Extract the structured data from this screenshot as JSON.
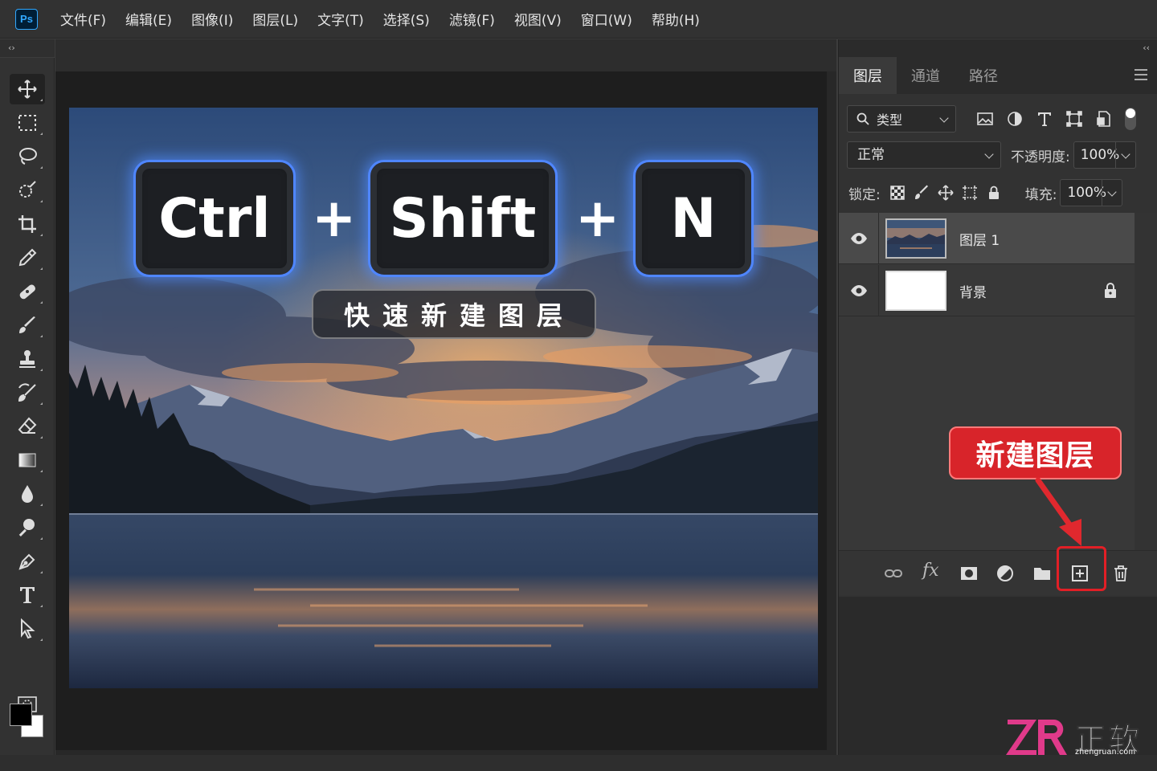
{
  "app": {
    "logo": "Ps"
  },
  "menubar": {
    "items": [
      "文件(F)",
      "编辑(E)",
      "图像(I)",
      "图层(L)",
      "文字(T)",
      "选择(S)",
      "滤镜(F)",
      "视图(V)",
      "窗口(W)",
      "帮助(H)"
    ]
  },
  "toolbar": {
    "collapse_glyph": "‹›",
    "tools": [
      "move-icon",
      "marquee-icon",
      "lasso-icon",
      "quick-select-icon",
      "crop-icon",
      "eyedropper-icon",
      "healing-brush-icon",
      "brush-icon",
      "clone-stamp-icon",
      "history-brush-icon",
      "eraser-icon",
      "gradient-icon",
      "blur-icon",
      "dodge-icon",
      "pen-icon",
      "type-icon",
      "path-select-icon",
      "quick-mask-icon"
    ],
    "foreground_color": "#000000",
    "background_color": "#ffffff"
  },
  "canvas": {
    "keys": [
      "Ctrl",
      "Shift",
      "N"
    ],
    "plus": "+",
    "caption": "快速新建图层",
    "key_glow_color": "#4f86ff"
  },
  "layers_panel": {
    "collapse_glyph": "‹‹",
    "tabs": [
      "图层",
      "通道",
      "路径"
    ],
    "active_tab": "图层",
    "filter": {
      "label": "类型",
      "icons": [
        "image-filter-icon",
        "adjustment-filter-icon",
        "type-filter-icon",
        "shape-filter-icon",
        "smart-object-filter-icon"
      ]
    },
    "blend_mode": "正常",
    "opacity_label": "不透明度:",
    "opacity": "100%",
    "lock_label": "锁定:",
    "fill_label": "填充:",
    "fill": "100%",
    "layers": [
      {
        "name": "图层 1",
        "visible": true,
        "selected": true,
        "locked": false
      },
      {
        "name": "背景",
        "visible": true,
        "selected": false,
        "locked": true
      }
    ],
    "footer_icons": [
      "link-icon",
      "fx-icon",
      "mask-icon",
      "adjustment-layer-icon",
      "group-folder-icon",
      "new-layer-icon",
      "delete-icon"
    ],
    "fx_label": "fx"
  },
  "callout": {
    "text": "新建图层",
    "color": "#d8242a"
  },
  "watermark": {
    "text": "正软",
    "sub": "zhengruan.com"
  }
}
